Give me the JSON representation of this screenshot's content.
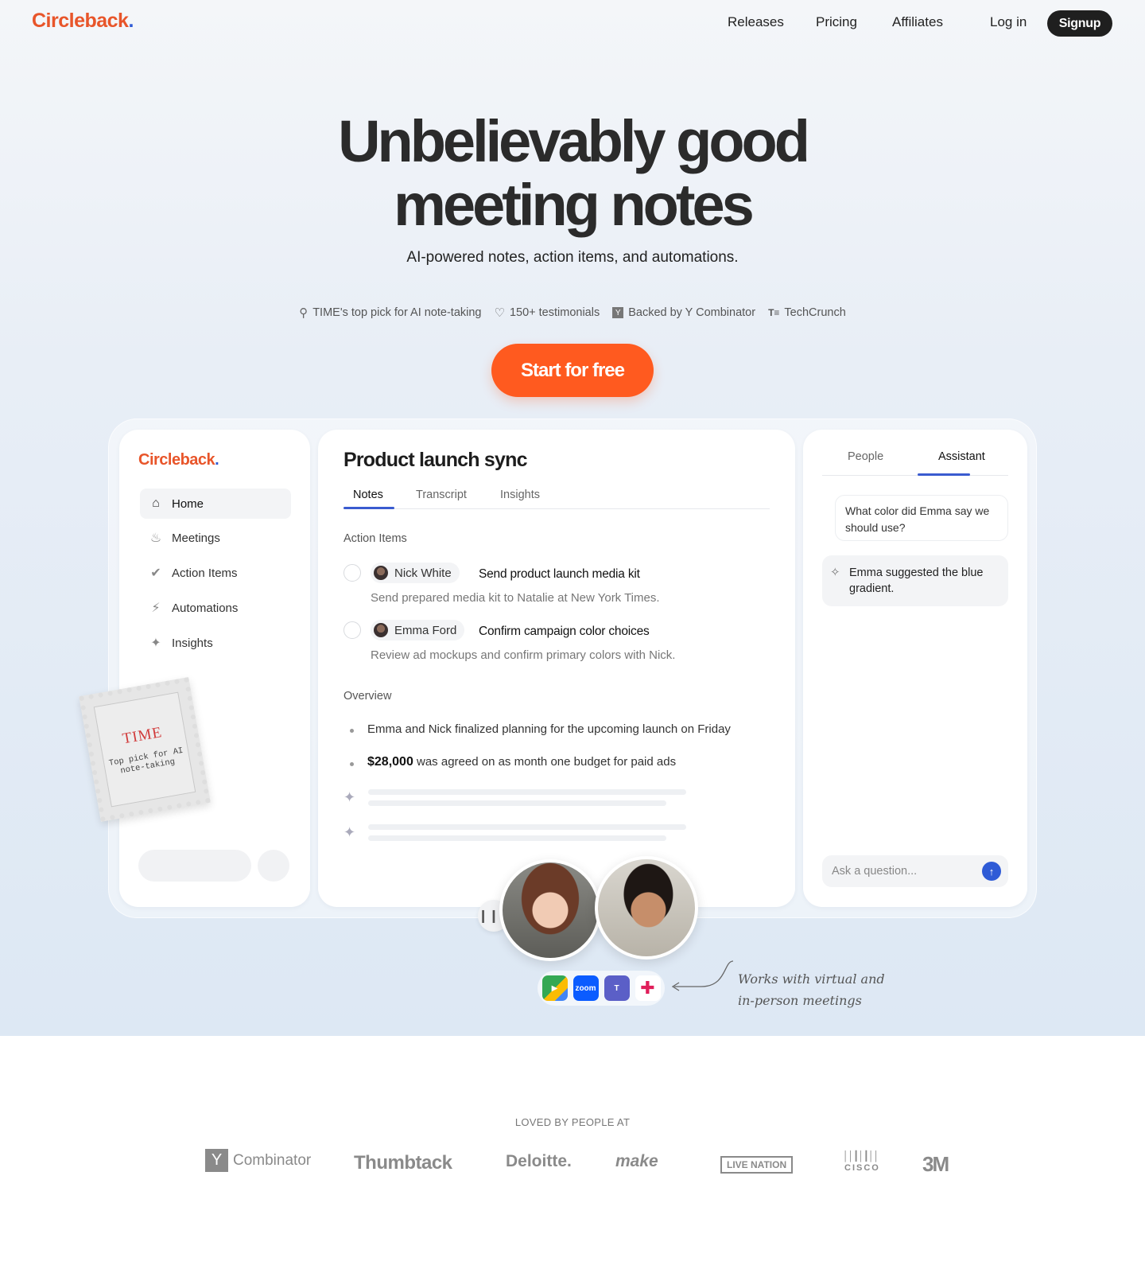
{
  "nav": {
    "brand": "Circleback",
    "links": [
      "Releases",
      "Pricing",
      "Affiliates",
      "Log in"
    ],
    "signup": "Signup"
  },
  "hero": {
    "headline_line1": "Unbelievably good",
    "headline_line2": "meeting notes",
    "subhead": "AI-powered notes, action items, and automations.",
    "badges": [
      {
        "icon": "award-icon",
        "text": "TIME's top pick for AI note-taking"
      },
      {
        "icon": "heart-icon",
        "text": "150+ testimonials"
      },
      {
        "icon": "ycombinator-icon",
        "text": "Backed by Y Combinator"
      },
      {
        "icon": "techcrunch-icon",
        "text": "TechCrunch"
      }
    ],
    "cta": "Start for free"
  },
  "app": {
    "sidebar": {
      "brand": "Circleback",
      "items": [
        {
          "icon": "home-icon",
          "label": "Home"
        },
        {
          "icon": "fire-icon",
          "label": "Meetings"
        },
        {
          "icon": "check-circle-icon",
          "label": "Action Items"
        },
        {
          "icon": "lightning-icon",
          "label": "Automations"
        },
        {
          "icon": "sparkles-icon",
          "label": "Insights"
        }
      ]
    },
    "stamp": {
      "title": "TIME",
      "text": "Top pick for AI note-taking"
    },
    "doc": {
      "title": "Product launch sync",
      "tabs": [
        "Notes",
        "Transcript",
        "Insights"
      ],
      "action_items_label": "Action Items",
      "action_items": [
        {
          "person": "Nick White",
          "title": "Send product launch media kit",
          "desc": "Send prepared media kit to Natalie at New York Times."
        },
        {
          "person": "Emma Ford",
          "title": "Confirm campaign color choices",
          "desc": "Review ad mockups and confirm primary colors with Nick."
        }
      ],
      "overview_label": "Overview",
      "overview": [
        {
          "bold": "",
          "text": "Emma and Nick finalized  planning for the upcoming launch on Friday"
        },
        {
          "bold": "$28,000",
          "text": " was agreed on as month one budget for paid ads"
        }
      ]
    },
    "assistant": {
      "tabs": [
        "People",
        "Assistant"
      ],
      "question": "What color did Emma say we should use?",
      "answer": "Emma suggested the blue gradient.",
      "placeholder": "Ask a question..."
    }
  },
  "integrations": {
    "apps": [
      "google-meet-icon",
      "zoom-icon",
      "teams-icon",
      "slack-icon"
    ],
    "zoom_label": "zoom",
    "note_line1": "Works with virtual and",
    "note_line2": "in-person meetings"
  },
  "logos": {
    "label": "LOVED BY PEOPLE AT",
    "yc_letter": "Y",
    "items": [
      "Combinator",
      "Thumbtack",
      "Deloitte.",
      "make",
      "LIVE NATION",
      "CISCO",
      "3M"
    ]
  },
  "colors": {
    "brand": "#e8552a",
    "cta": "#ff5a1f",
    "accent": "#2f5bd6"
  }
}
